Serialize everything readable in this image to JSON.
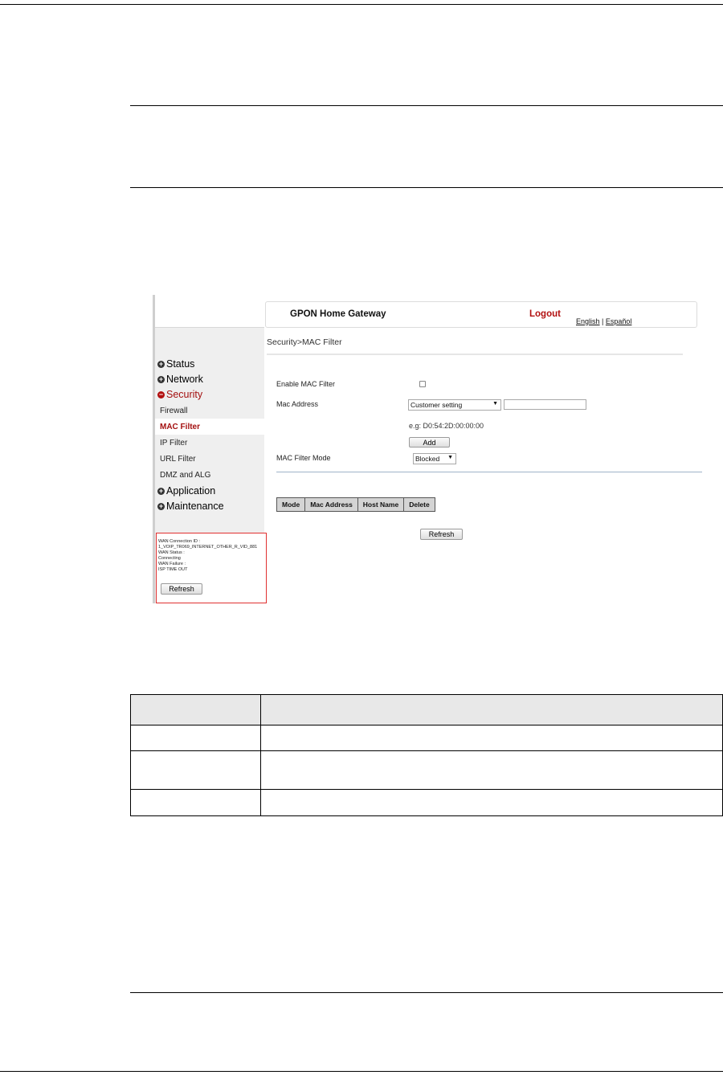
{
  "header": {
    "title": "GPON Home Gateway",
    "logout": "Logout",
    "lang_english": "English",
    "lang_sep": "|",
    "lang_spanish": "Español"
  },
  "breadcrumb": "Security>MAC Filter",
  "sidebar": {
    "main_items": [
      "Status",
      "Network",
      "Security",
      "Application",
      "Maintenance"
    ],
    "security_sub": [
      "Firewall",
      "MAC Filter",
      "IP Filter",
      "URL Filter",
      "DMZ and ALG"
    ],
    "active_sub": "MAC Filter"
  },
  "wan_status": {
    "connection_id_label": "WAN Connection ID :",
    "connection_id": "1_VOIP_TR069_INTERNET_OTHER_R_VID_881",
    "status_label": "WAN Status :",
    "status": "Connecting",
    "failure_label": "WAN Failure :",
    "failure": "ISP TIME OUT",
    "refresh": "Refresh"
  },
  "form": {
    "enable_label": "Enable MAC Filter",
    "enable_checked": false,
    "mac_label": "Mac Address",
    "mac_select": "Customer setting",
    "mac_value": "",
    "example": "e.g: D0:54:2D:00:00:00",
    "add": "Add",
    "mode_label": "MAC Filter Mode",
    "mode_select": "Blocked"
  },
  "list": {
    "columns": [
      "Mode",
      "Mac Address",
      "Host Name",
      "Delete"
    ]
  },
  "refresh": "Refresh",
  "icons": {
    "collapsed": "plus-icon",
    "expanded": "minus-icon",
    "dropdown": "chevron-down-icon"
  },
  "colors": {
    "accent_red": "#b21010",
    "sidebar_bg": "#efefef",
    "table_header_bg": "#d4d4d4"
  }
}
